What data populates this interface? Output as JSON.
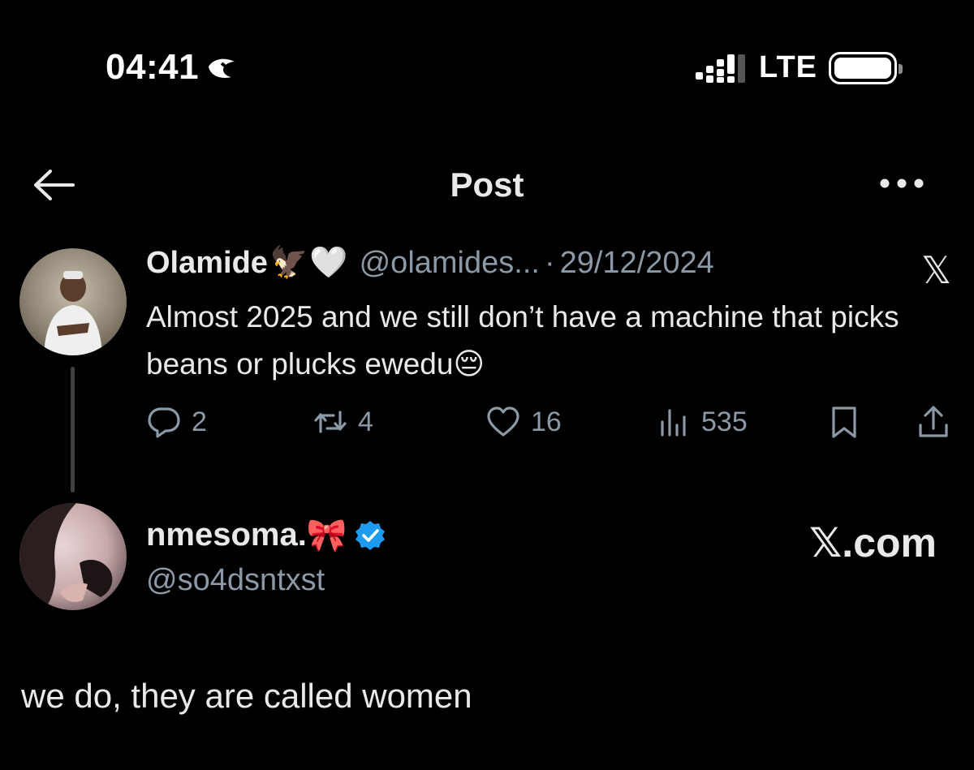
{
  "status_bar": {
    "time": "04:41",
    "network": "LTE",
    "icons": [
      "moon-sleep-icon",
      "signal-icon",
      "battery-icon"
    ]
  },
  "header": {
    "title": "Post",
    "back_icon": "arrow-left-icon",
    "more_icon": "more-horizontal-icon"
  },
  "quoted_post": {
    "display_name": "Olamide",
    "name_emojis": [
      "🦅",
      "🤍"
    ],
    "handle": "@olamides...",
    "date_sep": "·",
    "date": "29/12/2024",
    "platform_logo": "𝕏",
    "text": "Almost 2025 and we still don’t have a machine that picks beans or plucks ewedu",
    "text_emoji": "😔",
    "stats": {
      "replies": "2",
      "reposts": "4",
      "likes": "16",
      "views": "535"
    }
  },
  "reply": {
    "display_name": "nmesoma.",
    "name_emoji": "🎀",
    "verified": true,
    "handle": "@so4dsntxst",
    "watermark": "𝕏.com",
    "text": "we do, they are called women"
  },
  "colors": {
    "background": "#000000",
    "primary_text": "#e7e9ea",
    "secondary_text": "#8b98a5",
    "verified_blue": "#1d9bf0",
    "thread_line": "#3e4144"
  }
}
